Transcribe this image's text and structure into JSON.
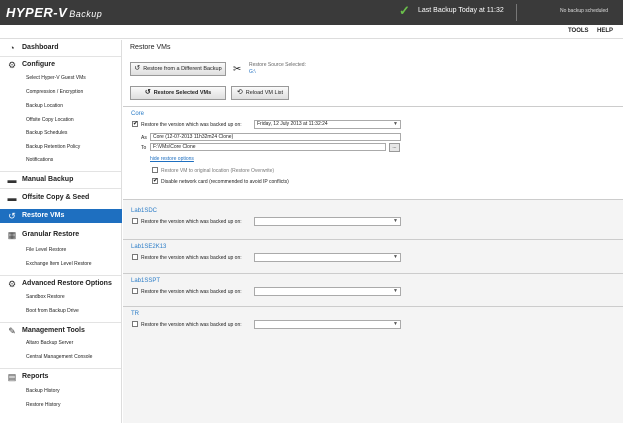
{
  "header": {
    "logo_main": "HYPER-V",
    "logo_sub": "Backup",
    "check_icon": "check-icon",
    "status_text": "Last Backup Today at 11:32",
    "schedule_text": "No backup scheduled"
  },
  "menu": {
    "tools": "TOOLS",
    "help": "HELP"
  },
  "sidebar": {
    "dashboard": "Dashboard",
    "configure": "Configure",
    "configure_items": [
      "Select Hyper-V Guest VMs",
      "Compression / Encryption",
      "Backup Location",
      "Offsite Copy Location",
      "Backup Schedules",
      "Backup Retention Policy",
      "Notifications"
    ],
    "manual_backup": "Manual Backup",
    "offsite_copy": "Offsite Copy & Seed",
    "restore_vms": "Restore VMs",
    "granular_restore": "Granular Restore",
    "granular_items": [
      "File Level Restore",
      "Exchange Item Level Restore"
    ],
    "advanced_restore": "Advanced Restore Options",
    "advanced_items": [
      "Sandbox Restore",
      "Boot from Backup Drive"
    ],
    "management_tools": "Management Tools",
    "management_items": [
      "Altaro Backup Server",
      "Central Management Console"
    ],
    "reports": "Reports",
    "report_items": [
      "Backup History",
      "Restore History"
    ]
  },
  "main": {
    "title": "Restore VMs",
    "btn_restore_different": "Restore from a Different Backup",
    "source_label": "Restore Source Selected:",
    "source_value": "G:\\",
    "btn_restore_selected": "Restore Selected  VMs",
    "btn_reload": "Reload VM List",
    "vms": [
      {
        "name": "Core",
        "checked": "✔",
        "restore_label": "Restore the version which was backed up on:",
        "date": "Friday, 12 July 2013 at 11:32:24",
        "as_label": "As",
        "as_value": "Core (12-07-2013 11h32m24 Clone)",
        "to_label": "To",
        "to_value": "F:\\VMs\\Core Clone",
        "browse": "...",
        "hide_link": "hide restore options",
        "opt_original": "Restore VM to original location (Restore Overwrite)",
        "opt_original_checked": "",
        "opt_disable_nic": "Disable network card (recommended to avoid IP conflicts)",
        "opt_disable_nic_checked": "✔"
      },
      {
        "name": "Lab1SDC",
        "checked": "",
        "restore_label": "Restore the version which was backed up on:",
        "date": ""
      },
      {
        "name": "Lab1SE2K13",
        "checked": "",
        "restore_label": "Restore the version which was backed up on:",
        "date": ""
      },
      {
        "name": "Lab1SSPT",
        "checked": "",
        "restore_label": "Restore the version which was backed up on:",
        "date": ""
      },
      {
        "name": "TR",
        "checked": "",
        "restore_label": "Restore the version which was backed up on:",
        "date": ""
      }
    ]
  },
  "colors": {
    "accent": "#1e6fc0",
    "topbar": "#3a3a3a",
    "check": "#6bc04b",
    "vm_name": "#2a7cc7"
  }
}
